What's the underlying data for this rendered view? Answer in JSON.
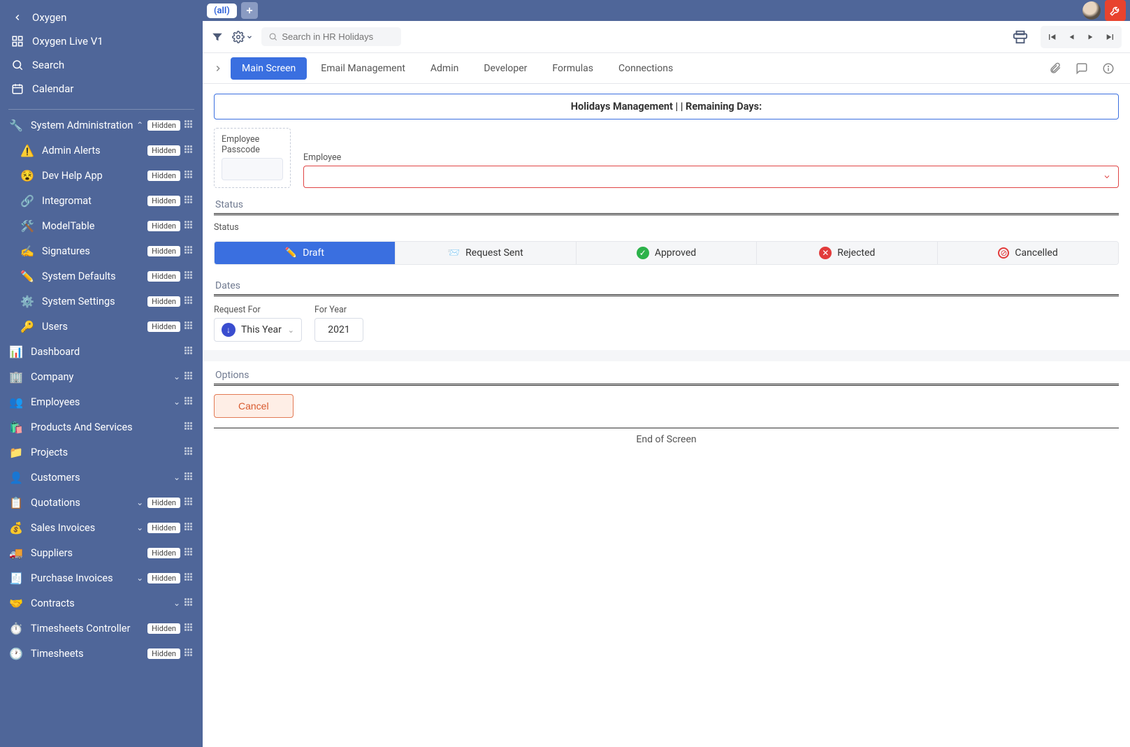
{
  "app": {
    "name": "Oxygen"
  },
  "sidebar": {
    "top": [
      {
        "label": "Oxygen Live V1"
      },
      {
        "label": "Search"
      },
      {
        "label": "Calendar"
      }
    ],
    "items": [
      {
        "label": "System Administration",
        "hidden": "Hidden",
        "expandable": true,
        "expanded": true,
        "children": [
          {
            "label": "Admin Alerts",
            "hidden": "Hidden"
          },
          {
            "label": "Dev Help App",
            "hidden": "Hidden"
          },
          {
            "label": "Integromat",
            "hidden": "Hidden"
          },
          {
            "label": "ModelTable",
            "hidden": "Hidden"
          },
          {
            "label": "Signatures",
            "hidden": "Hidden"
          },
          {
            "label": "System Defaults",
            "hidden": "Hidden"
          },
          {
            "label": "System Settings",
            "hidden": "Hidden"
          },
          {
            "label": "Users",
            "hidden": "Hidden"
          }
        ]
      },
      {
        "label": "Dashboard"
      },
      {
        "label": "Company",
        "expandable": true
      },
      {
        "label": "Employees",
        "expandable": true
      },
      {
        "label": "Products And Services"
      },
      {
        "label": "Projects"
      },
      {
        "label": "Customers",
        "expandable": true
      },
      {
        "label": "Quotations",
        "hidden": "Hidden",
        "expandable": true
      },
      {
        "label": "Sales Invoices",
        "hidden": "Hidden",
        "expandable": true
      },
      {
        "label": "Suppliers",
        "hidden": "Hidden"
      },
      {
        "label": "Purchase Invoices",
        "hidden": "Hidden",
        "expandable": true
      },
      {
        "label": "Contracts",
        "expandable": true
      },
      {
        "label": "Timesheets Controller",
        "hidden": "Hidden"
      },
      {
        "label": "Timesheets",
        "hidden": "Hidden"
      }
    ]
  },
  "topTabs": {
    "all": "(all)"
  },
  "search": {
    "placeholder": "Search in HR Holidays"
  },
  "tabs": [
    "Main Screen",
    "Email Management",
    "Admin",
    "Developer",
    "Formulas",
    "Connections"
  ],
  "form": {
    "banner": "Holidays Management |  | Remaining Days:",
    "passcodeLabel": "Employee Passcode",
    "employeeLabel": "Employee",
    "sections": {
      "status": "Status",
      "dates": "Dates",
      "options": "Options"
    },
    "statusField": "Status",
    "statuses": [
      "Draft",
      "Request Sent",
      "Approved",
      "Rejected",
      "Cancelled"
    ],
    "requestForLabel": "Request For",
    "requestForValue": "This Year",
    "forYearLabel": "For Year",
    "forYearValue": "2021",
    "cancel": "Cancel",
    "end": "End of Screen"
  }
}
